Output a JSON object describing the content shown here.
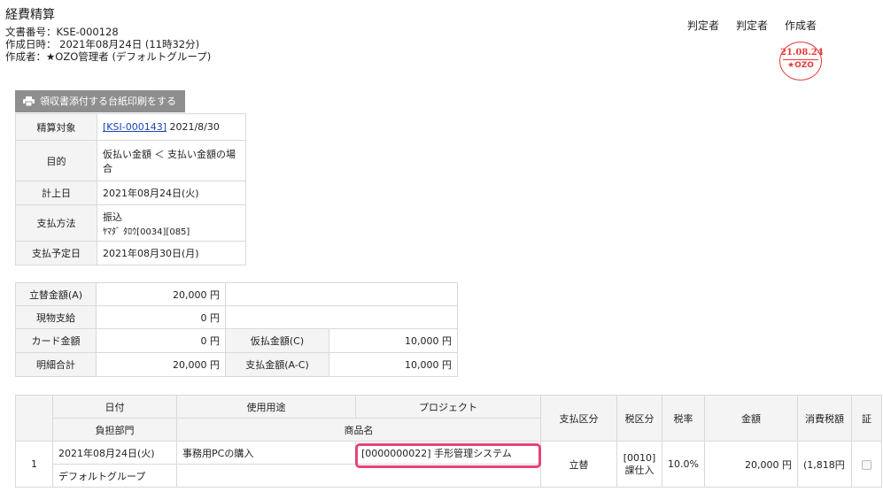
{
  "header": {
    "title": "経費精算",
    "doc_number": "文書番号：KSE-000128",
    "created_at": "作成日時： 2021年08月24日 (11時32分)",
    "creator": "作成者：★OZO管理者 (デフォルトグループ)"
  },
  "approvers": {
    "judge1": "判定者",
    "judge2": "判定者",
    "creator": "作成者",
    "stamp_date": "21.08.24",
    "stamp_name": "★OZO"
  },
  "print_button": {
    "label": "領収書添付する台紙印刷をする",
    "icon": "printer-icon"
  },
  "info": {
    "target_label": "精算対象",
    "target_link": "[KSI-000143]",
    "target_date": "2021/8/30",
    "purpose_label": "目的",
    "purpose_value": "仮払い金額 ＜ 支払い金額の場合",
    "posting_label": "計上日",
    "posting_value": "2021年08月24日(火)",
    "method_label": "支払方法",
    "method_value": "振込",
    "method_sub": "ﾔﾏﾀﾞ ﾀﾛｳ[0034][085]",
    "due_label": "支払予定日",
    "due_value": "2021年08月30日(月)"
  },
  "amounts": {
    "advance_label": "立替金額(A)",
    "advance_value": "20,000 円",
    "cash_label": "現物支給",
    "cash_value": "0 円",
    "card_label": "カード金額",
    "card_value": "0 円",
    "prepaid_label": "仮払金額(C)",
    "prepaid_value": "10,000 円",
    "detail_label": "明細合計",
    "detail_value": "20,000 円",
    "payment_label": "支払金額(A-C)",
    "payment_value": "10,000 円"
  },
  "detail": {
    "headers": {
      "date": "日付",
      "usage": "使用用途",
      "project": "プロジェクト",
      "dept": "負担部門",
      "product": "商品名",
      "pay_type": "支払区分",
      "tax_type": "税区分",
      "tax_rate": "税率",
      "amount": "金額",
      "tax": "消費税額",
      "receipt": "証"
    },
    "rows": [
      {
        "no": "1",
        "date": "2021年08月24日(火)",
        "usage": "事務用PCの購入",
        "project": "[0000000022] 手形管理システム",
        "dept": "デフォルトグループ",
        "product": "",
        "pay_type": "立替",
        "tax_type_1": "[0010]",
        "tax_type_2": "課仕入",
        "tax_rate": "10.0%",
        "amount": "20,000 円",
        "tax": "(1,818円"
      }
    ]
  },
  "colors": {
    "highlight": "#e4457a",
    "stamp": "#e53b3b",
    "link": "#1a45b8"
  }
}
